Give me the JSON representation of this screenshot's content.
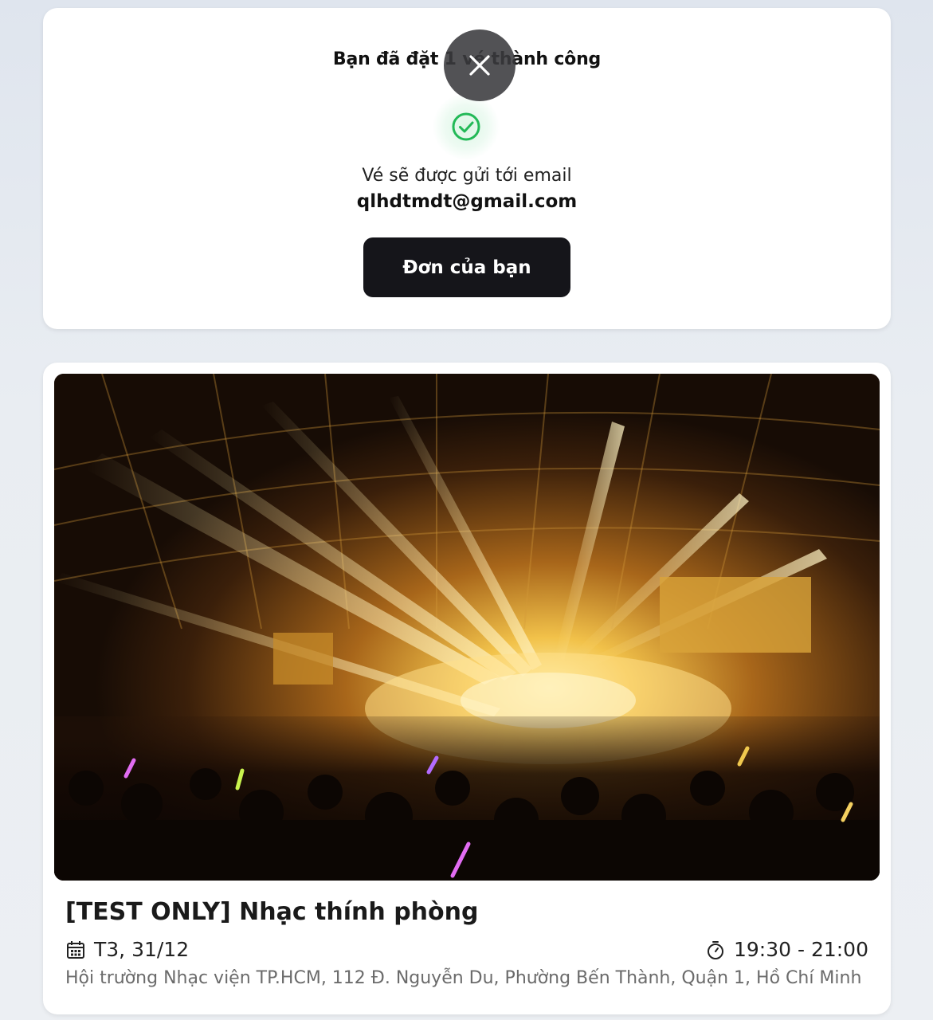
{
  "success": {
    "title": "Bạn đã đặt 1 vé thành công",
    "email_label": "Vé sẽ được gửi tới email",
    "email": "qlhdtmdt@gmail.com",
    "orders_button": "Đơn của bạn",
    "close_icon": "close-icon",
    "status_icon": "check-circle-icon"
  },
  "event": {
    "title": "[TEST ONLY] Nhạc thính phòng",
    "date": "T3, 31/12",
    "date_icon": "calendar-icon",
    "time": "19:30 - 21:00",
    "time_icon": "stopwatch-icon",
    "venue": "Hội trường Nhạc viện TP.HCM, 112 Đ. Nguyễn Du, Phường Bến Thành, Quận 1, Hồ Chí Minh"
  },
  "colors": {
    "primary_button": "#15151a",
    "success_green": "#22c55e",
    "muted_text": "#6b6b6b"
  }
}
